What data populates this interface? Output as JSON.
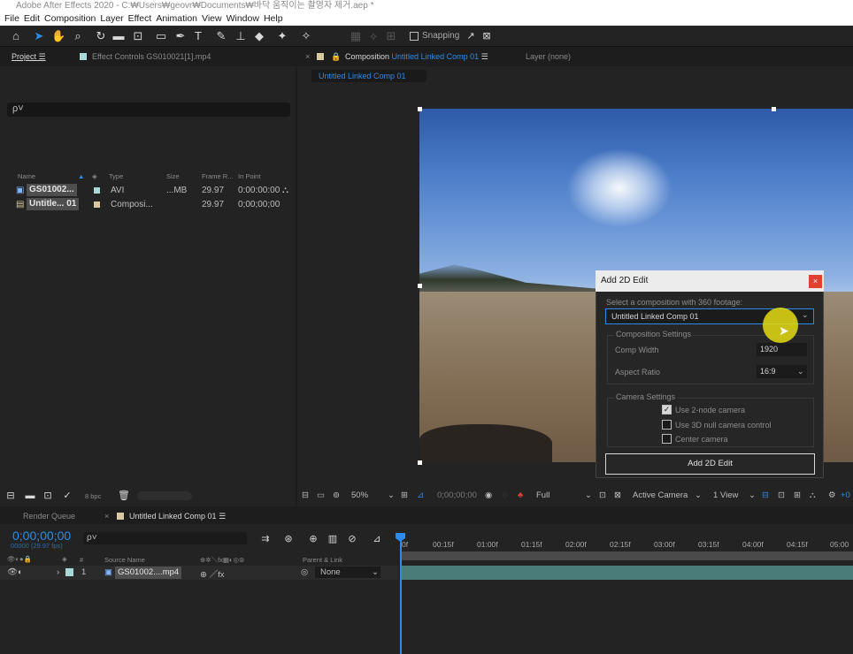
{
  "app": {
    "logo": "Ae",
    "window_title": "Adobe After Effects 2020 - C:₩Users₩geovr₩Documents₩바닥 움직이는 촬영자 제거.aep *"
  },
  "menu": [
    "File",
    "Edit",
    "Composition",
    "Layer",
    "Effect",
    "Animation",
    "View",
    "Window",
    "Help"
  ],
  "toolbar": {
    "snapping_label": "Snapping",
    "snapping_checked": false
  },
  "project_panel": {
    "tab_project": "Project",
    "tab_effect_controls": "Effect Controls GS010021[1].mp4",
    "search_placeholder": "ρ˅",
    "columns": [
      "Name",
      "Type",
      "Size",
      "Frame R...",
      "In Point"
    ],
    "rows": [
      {
        "name": "GS01002...",
        "type": "AVI",
        "size": "...MB",
        "frame_rate": "29.97",
        "in_point": "0:00:00:00"
      },
      {
        "name": "Untitle... 01",
        "type": "Composi...",
        "size": "",
        "frame_rate": "29.97",
        "in_point": "0;00;00;00"
      }
    ],
    "bpc": "8 bpc"
  },
  "comp_panel": {
    "tab_label_prefix": "Composition",
    "tab_comp_name": "Untitled Linked Comp 01",
    "layer_tab": "Layer",
    "layer_tab_value": "(none)",
    "sub_tab": "Untitled Linked Comp 01",
    "bottom": {
      "zoom": "50%",
      "timecode": "0;00;00;00",
      "resolution": "Full",
      "camera": "Active Camera",
      "views": "1 View",
      "plus_offset": "+0"
    }
  },
  "dialog": {
    "title": "Add 2D Edit",
    "close_icon": "×",
    "select_label": "Select a composition with 360 footage:",
    "selected_comp": "Untitled Linked Comp 01",
    "comp_settings_label": "Composition Settings",
    "comp_width_label": "Comp Width",
    "comp_width_value": "1920",
    "aspect_ratio_label": "Aspect Ratio",
    "aspect_ratio_value": "16:9",
    "camera_settings_label": "Camera Settings",
    "checkboxes": [
      {
        "label": "Use 2-node camera",
        "checked": true
      },
      {
        "label": "Use 3D null camera control",
        "checked": false
      },
      {
        "label": "Center camera",
        "checked": false
      }
    ],
    "submit_label": "Add 2D Edit"
  },
  "timeline": {
    "tab_render_queue": "Render Queue",
    "tab_comp": "Untitled Linked Comp 01",
    "timecode": "0;00;00;00",
    "fps": "00000 (29.97 fps)",
    "search_placeholder": "ρ˅",
    "ruler_ticks": [
      "0f",
      "00:15f",
      "01:00f",
      "01:15f",
      "02:00f",
      "02:15f",
      "03:00f",
      "03:15f",
      "04:00f",
      "04:15f",
      "05:00"
    ],
    "layer_headers": {
      "hash": "#",
      "source_name": "Source Name",
      "parent": "Parent & Link"
    },
    "layers": [
      {
        "index": "1",
        "name": "GS01002....mp4",
        "parent": "None"
      }
    ]
  },
  "colors": {
    "accent": "#2d8ceb",
    "close_red": "#e0412f",
    "label_footage": "#a8d8d8",
    "label_comp": "#d8c8a0",
    "layer_bar": "#4a7c7a",
    "cursor_highlight": "#e6dc14"
  }
}
